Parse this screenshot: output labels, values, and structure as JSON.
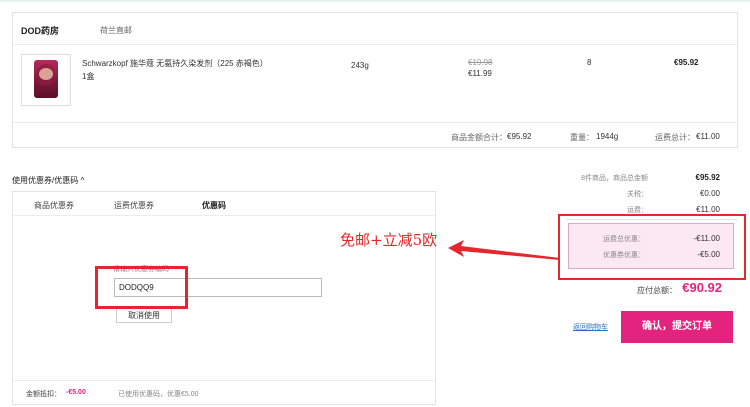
{
  "shop": {
    "name": "DOD药房",
    "tag": "荷兰直邮"
  },
  "product": {
    "name": "Schwarzkopf 施华蔻 无氨持久染发剂（225 赤褐色）",
    "qty_note": "1盒",
    "weight": "243g",
    "price_old": "€19.98",
    "price_new": "€11.99",
    "count": "8",
    "total": "€95.92"
  },
  "summary": {
    "goods_label": "商品金额合计：",
    "goods_value": "€95.92",
    "weight_label": "重量：",
    "weight_value": "1944g",
    "ship_label": "运费总计：",
    "ship_value": "€11.00"
  },
  "coupon": {
    "toggle_label": "使用优惠券/优惠码 ^",
    "tabs": [
      "商品优惠券",
      "运费优惠券",
      "优惠码"
    ],
    "code_label": "请输入优惠券编码",
    "code_value": "DODQQ9",
    "cancel_label": "取消使用",
    "deduct_label": "金额抵扣：",
    "deduct_value": "-€5.00",
    "used_note": "已使用优惠码，优惠€5.00"
  },
  "totals": {
    "items_label": "8件商品，商品总金额",
    "items_value": "€95.92",
    "tax_label": "关税：",
    "tax_value": "€0.00",
    "ship_label": "运费：",
    "ship_value": "€11.00",
    "ship_discount_label": "运费总优惠：",
    "ship_discount_value": "-€11.00",
    "coupon_discount_label": "优惠券优惠：",
    "coupon_discount_value": "-€5.00",
    "pay_label": "应付总额：",
    "pay_value": "€90.92"
  },
  "actions": {
    "back_label": "返回购物车",
    "submit_label": "确认，提交订单"
  },
  "annotation": {
    "text": "免邮+立减5欧"
  },
  "colors": {
    "accent": "#e4237e",
    "annotation_red": "#e5262c",
    "link": "#2a6ebb"
  }
}
